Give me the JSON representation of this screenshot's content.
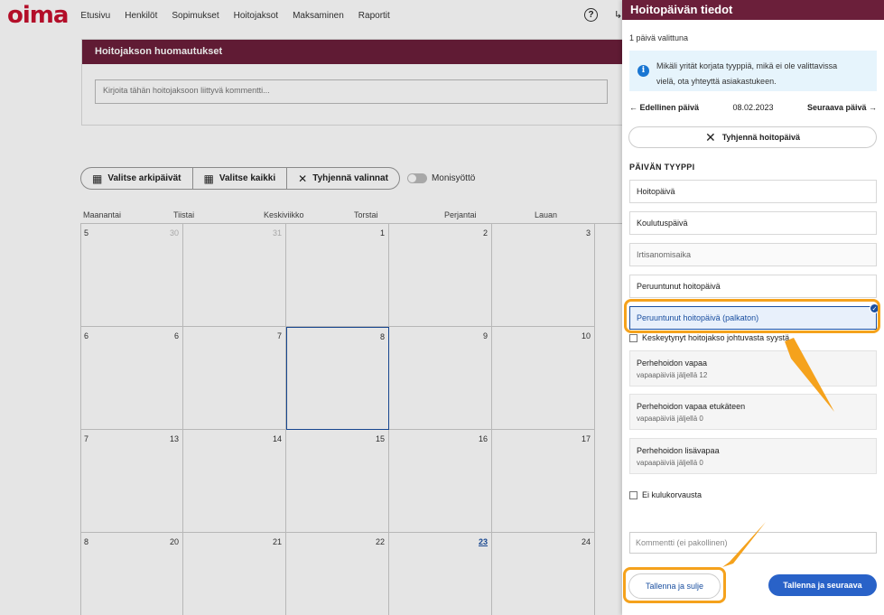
{
  "app": {
    "logo": "oima"
  },
  "nav": {
    "items": [
      "Etusivu",
      "Henkilöt",
      "Sopimukset",
      "Hoitojaksot",
      "Maksaminen",
      "Raportit"
    ]
  },
  "notes": {
    "title": "Hoitojakson huomautukset",
    "placeholder": "Kirjoita tähän hoitojaksoon liittyvä kommentti..."
  },
  "toolbar": {
    "select_weekdays": "Valitse arkipäivät",
    "select_all": "Valitse kaikki",
    "clear_selections": "Tyhjennä valinnat",
    "multi_input": "Monisyöttö"
  },
  "calendar": {
    "weekdays": [
      "Maanantai",
      "Tiistai",
      "Keskiviikko",
      "Torstai",
      "Perjantai",
      "Lauan"
    ],
    "weeks": [
      {
        "week": "5",
        "days": [
          "30",
          "31",
          "1",
          "2",
          "3"
        ]
      },
      {
        "week": "6",
        "days": [
          "6",
          "7",
          "8",
          "9",
          "10"
        ]
      },
      {
        "week": "7",
        "days": [
          "13",
          "14",
          "15",
          "16",
          "17"
        ]
      },
      {
        "week": "8",
        "days": [
          "20",
          "21",
          "22",
          "23",
          "24"
        ]
      }
    ]
  },
  "panel": {
    "title": "Hoitopäivän tiedot",
    "selected_count": "1 päivä valittuna",
    "info_text_1": "Mikäli yrität korjata tyyppiä, mikä ei ole valittavissa",
    "info_text_2": "vielä, ota yhteyttä asiakastukeen.",
    "prev_day": "Edellinen päivä",
    "date": "08.02.2023",
    "next_day": "Seuraava päivä",
    "clear_day": "Tyhjennä hoitopäivä",
    "section_label": "PÄIVÄN TYYPPI",
    "options": {
      "o1": "Hoitopäivä",
      "o2": "Koulutuspäivä",
      "o3": "Irtisanomisaika",
      "o4": "Peruuntunut hoitopäivä",
      "o5": "Peruuntunut hoitopäivä (palkaton)"
    },
    "interrupted_label": "Keskeytynyt hoitojakso johtuvasta syystä",
    "leave": {
      "l1": {
        "title": "Perhehoidon vapaa",
        "sub": "vapaapäiviä jäljellä 12"
      },
      "l2": {
        "title": "Perhehoidon vapaa etukäteen",
        "sub": "vapaapäiviä jäljellä 0"
      },
      "l3": {
        "title": "Perhehoidon lisävapaa",
        "sub": "vapaapäiviä jäljellä 0"
      }
    },
    "no_expense": "Ei kulukorvausta",
    "comment_placeholder": "Kommentti (ei pakollinen)",
    "save_close": "Tallenna ja sulje",
    "save_next": "Tallenna ja seuraava"
  },
  "colors": {
    "brand_red": "#c8102e",
    "header_maroon": "#6b1f3a",
    "primary_blue": "#2962c8",
    "highlight_orange": "#f5a21c",
    "info_bg": "#e6f4fc"
  }
}
